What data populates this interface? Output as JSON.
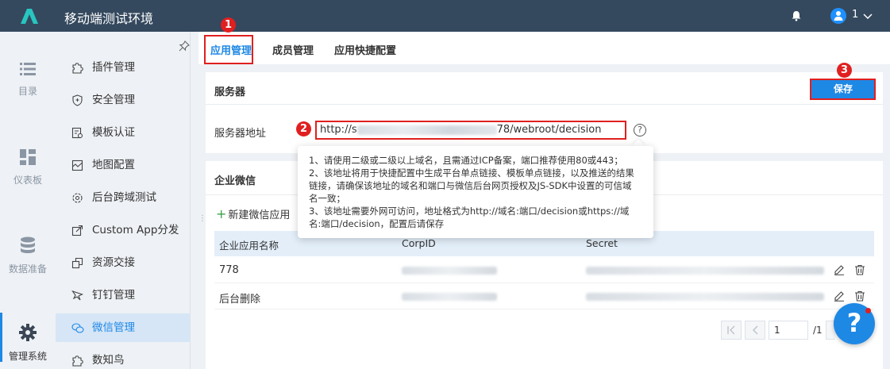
{
  "app": {
    "title": "移动端测试环境",
    "user_count": "1"
  },
  "rail": {
    "items": [
      {
        "label": "目录",
        "icon": "list-icon"
      },
      {
        "label": "仪表板",
        "icon": "dashboard-icon"
      },
      {
        "label": "数据准备",
        "icon": "database-icon"
      },
      {
        "label": "管理系统",
        "icon": "gear-icon"
      }
    ]
  },
  "submenu": {
    "items": [
      {
        "label": "插件管理",
        "icon": "puzzle-icon"
      },
      {
        "label": "安全管理",
        "icon": "shield-icon"
      },
      {
        "label": "模板认证",
        "icon": "template-icon"
      },
      {
        "label": "地图配置",
        "icon": "map-icon"
      },
      {
        "label": "后台跨域测试",
        "icon": "gear-icon"
      },
      {
        "label": "Custom App分发",
        "icon": "share-icon"
      },
      {
        "label": "资源交接",
        "icon": "transfer-icon"
      },
      {
        "label": "钉钉管理",
        "icon": "dingtalk-icon"
      },
      {
        "label": "微信管理",
        "icon": "wechat-icon"
      },
      {
        "label": "数知鸟",
        "icon": "puzzle-icon"
      }
    ]
  },
  "tabs": [
    {
      "label": "应用管理"
    },
    {
      "label": "成员管理"
    },
    {
      "label": "应用快捷配置"
    }
  ],
  "annotations": {
    "one": "1",
    "two": "2",
    "three": "3"
  },
  "server": {
    "title": "服务器",
    "save_label": "保存",
    "address_label": "服务器地址",
    "url_prefix": "http://s",
    "url_suffix": "78/webroot/decision",
    "help_glyph": "?"
  },
  "tooltip": {
    "lines": [
      "1、请使用二级或二级以上域名，且需通过ICP备案，端口推荐使用80或443；",
      "2、该地址将用于快捷配置中生成平台单点链接、模板单点链接，以及推送的结果链接，请确保该地址的域名和端口与微信后台网页授权及JS-SDK中设置的可信域名一致；",
      "3、该地址需要外网可访问，地址格式为http://域名:端口/decision或https://域名:端口/decision，配置后请保存"
    ]
  },
  "wechat": {
    "title": "企业微信",
    "new_app_label": "新建微信应用",
    "columns": [
      "企业应用名称",
      "CorpID",
      "Secret"
    ],
    "rows": [
      {
        "name": "778"
      },
      {
        "name": "后台删除"
      }
    ]
  },
  "pagination": {
    "current": "1",
    "total": "/1"
  },
  "help_fab": "?"
}
